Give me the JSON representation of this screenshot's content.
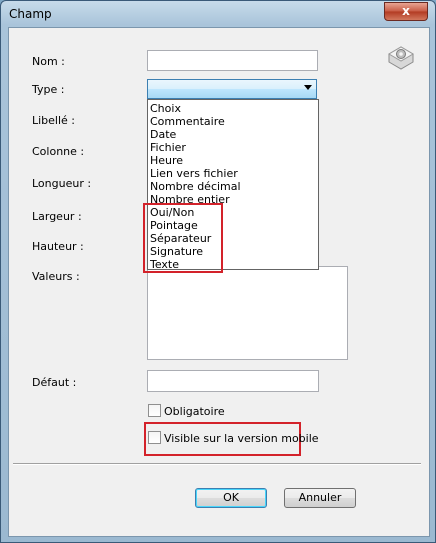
{
  "window": {
    "title": "Champ",
    "close_label": "x"
  },
  "form": {
    "labels": {
      "nom": "Nom :",
      "type": "Type :",
      "libelle": "Libellé :",
      "colonne": "Colonne :",
      "longueur": "Longueur :",
      "largeur": "Largeur :",
      "hauteur": "Hauteur :",
      "valeurs": "Valeurs :",
      "defaut": "Défaut :"
    },
    "nom_value": "",
    "type_value": "",
    "defaut_value": "",
    "type_options": [
      "Choix",
      "Commentaire",
      "Date",
      "Fichier",
      "Heure",
      "Lien vers fichier",
      "Nombre décimal",
      "Nombre entier",
      "Oui/Non",
      "Pointage",
      "Séparateur",
      "Signature",
      "Texte"
    ],
    "obligatoire_label": "Obligatoire",
    "visible_mobile_label": "Visible sur la version mobile"
  },
  "buttons": {
    "ok": "OK",
    "annuler": "Annuler"
  },
  "colors": {
    "highlight_red": "#d3222a",
    "accent_blue": "#3c7fb1"
  },
  "icons": {
    "settings": "gear-icon"
  }
}
